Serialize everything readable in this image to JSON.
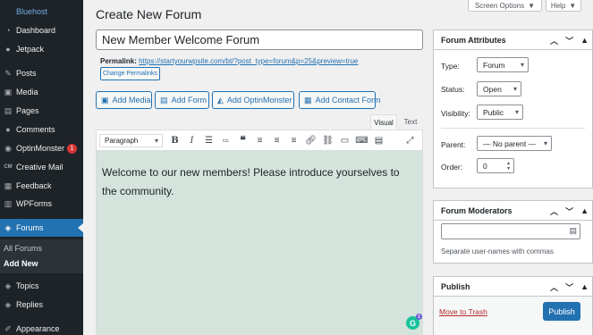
{
  "sidebar": {
    "site": "Bluehost",
    "items": [
      {
        "label": "Dashboard",
        "icon": "dashboard-icon",
        "glyph": "◔"
      },
      {
        "label": "Jetpack",
        "icon": "jetpack-icon",
        "glyph": "●"
      },
      {
        "label": "Posts",
        "icon": "pin-icon",
        "glyph": "✎"
      },
      {
        "label": "Media",
        "icon": "media-icon",
        "glyph": "▣"
      },
      {
        "label": "Pages",
        "icon": "pages-icon",
        "glyph": "▤"
      },
      {
        "label": "Comments",
        "icon": "comments-icon",
        "glyph": "●"
      },
      {
        "label": "OptinMonster",
        "icon": "optinmonster-icon",
        "glyph": "◉",
        "badge": "1"
      },
      {
        "label": "Creative Mail",
        "icon": "creative-mail-icon",
        "glyph": "CM"
      },
      {
        "label": "Feedback",
        "icon": "feedback-icon",
        "glyph": "▦"
      },
      {
        "label": "WPForms",
        "icon": "wpforms-icon",
        "glyph": "▥"
      },
      {
        "label": "Forums",
        "icon": "forums-icon",
        "glyph": "◈"
      },
      {
        "label": "Topics",
        "icon": "topics-icon",
        "glyph": "◈"
      },
      {
        "label": "Replies",
        "icon": "replies-icon",
        "glyph": "◈"
      },
      {
        "label": "Appearance",
        "icon": "appearance-icon",
        "glyph": "✐"
      }
    ],
    "submenu": {
      "all": "All Forums",
      "add": "Add New"
    }
  },
  "top": {
    "screen_options": "Screen Options",
    "help": "Help"
  },
  "page": {
    "title": "Create New Forum",
    "forum_title_value": "New Member Welcome Forum",
    "permalink_label": "Permalink:",
    "permalink_url": "https://startyourwpsite.com/bt/?post_type=forum&p=25&preview=true",
    "change_permalinks": "Change Permalinks"
  },
  "media_buttons": {
    "add_media": "Add Media",
    "add_form": "Add Form",
    "add_optinmonster": "Add OptinMonster",
    "add_contact_form": "Add Contact Form"
  },
  "editor": {
    "tab_visual": "Visual",
    "tab_text": "Text",
    "format": "Paragraph",
    "content": "Welcome to our new members! Please introduce yourselves to the community.",
    "grammarly_badge": "1"
  },
  "forum_attributes": {
    "title": "Forum Attributes",
    "type_label": "Type:",
    "type_value": "Forum",
    "status_label": "Status:",
    "status_value": "Open",
    "visibility_label": "Visibility:",
    "visibility_value": "Public",
    "parent_label": "Parent:",
    "parent_value": "— No parent —",
    "order_label": "Order:",
    "order_value": "0"
  },
  "forum_moderators": {
    "title": "Forum Moderators",
    "input_value": "",
    "hint": "Separate user-names with commas"
  },
  "publish": {
    "title": "Publish",
    "move_to_trash": "Move to Trash",
    "publish_button": "Publish"
  },
  "colors": {
    "sidebar_bg": "#1d2327",
    "accent": "#2271b1",
    "editor_bg": "#d4e3dc",
    "trash": "#b32d2e"
  }
}
